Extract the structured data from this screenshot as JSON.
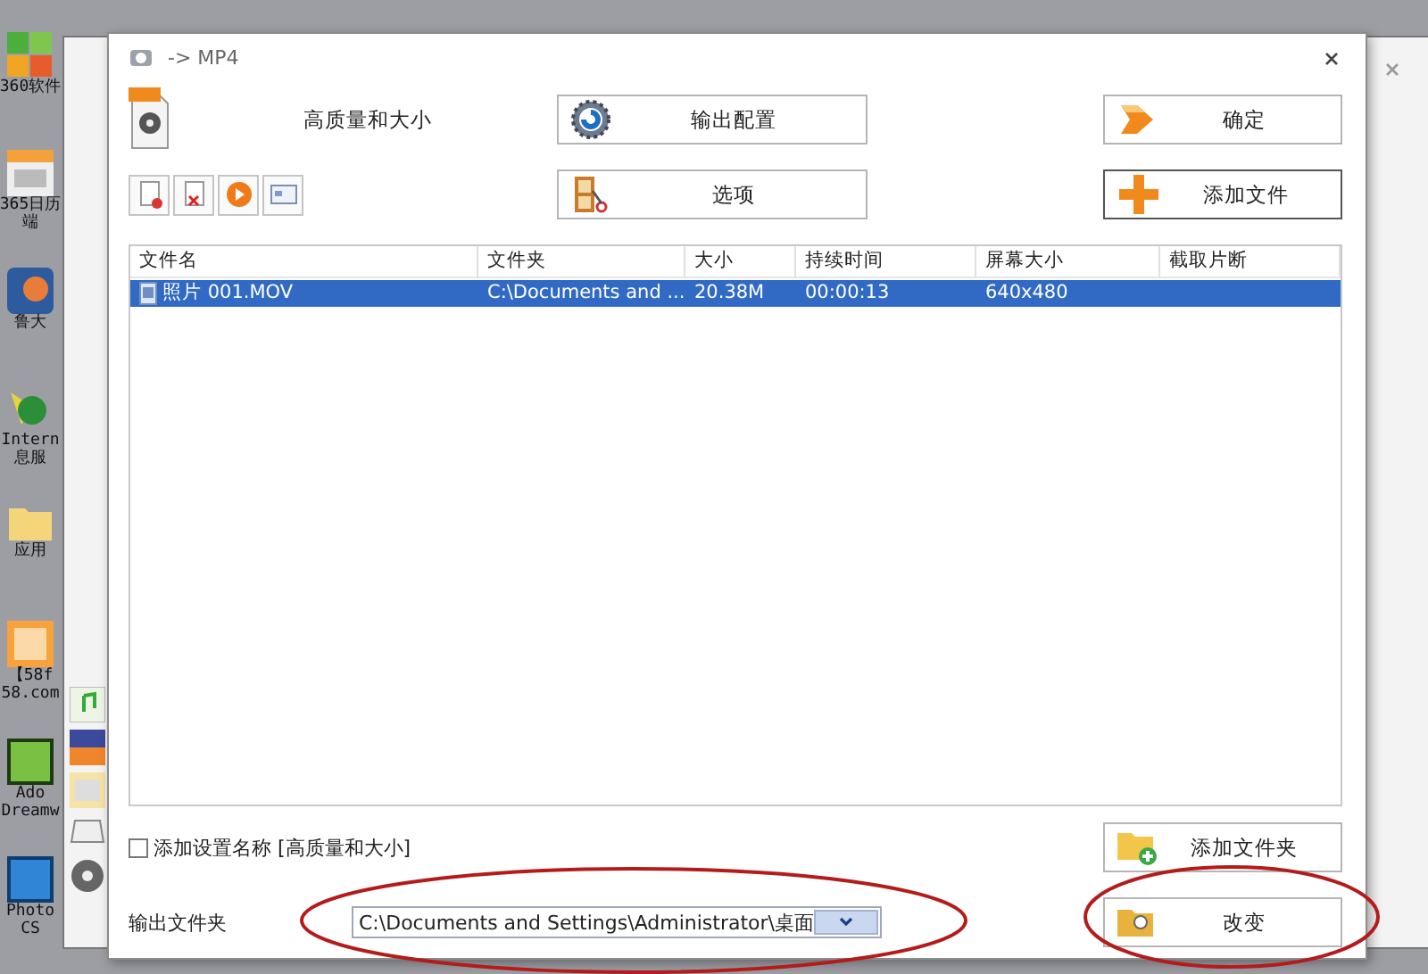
{
  "desktop_icons": [
    {
      "kind": "grid",
      "labels": [
        "360软件"
      ]
    },
    {
      "kind": "calendar",
      "labels": [
        "365日历",
        "端"
      ]
    },
    {
      "kind": "person",
      "labels": [
        "鲁大"
      ]
    },
    {
      "kind": "globe",
      "labels": [
        "Intern",
        "息服"
      ]
    },
    {
      "kind": "folder",
      "labels": [
        "应用"
      ]
    },
    {
      "kind": "fiftyeight",
      "labels": [
        "【58f",
        "58.com"
      ]
    },
    {
      "kind": "dw",
      "labels": [
        "Ado",
        "Dreamw"
      ]
    },
    {
      "kind": "ps",
      "labels": [
        "Photo",
        "CS"
      ]
    }
  ],
  "dialog": {
    "title": "-> MP4",
    "profile": "高质量和大小",
    "buttons": [
      {
        "label": "输出配置",
        "kind": "gear",
        "focused": false
      },
      {
        "label": "确定",
        "kind": "arrow",
        "focused": false
      },
      {
        "label": "选项",
        "kind": "film",
        "focused": false
      },
      {
        "label": "添加文件",
        "kind": "plus",
        "focused": true
      }
    ],
    "table": {
      "columns": [
        "文件名",
        "文件夹",
        "大小",
        "持续时间",
        "屏幕大小",
        "截取片断"
      ],
      "rows": [
        {
          "cells": [
            "照片 001.MOV",
            "C:\\Documents and ...",
            "20.38M",
            "00:00:13",
            "640x480"
          ],
          "selected": true
        }
      ]
    },
    "add_name_checkbox": {
      "label": "添加设置名称 [高质量和大小]",
      "checked": false
    },
    "add_folder_button": {
      "label": "添加文件夹",
      "kind": "folder-plus"
    },
    "output_folder": {
      "label": "输出文件夹",
      "value": "C:\\Documents and Settings\\Administrator\\桌面"
    },
    "change_button": {
      "label": "改变",
      "kind": "folder-gear"
    }
  }
}
